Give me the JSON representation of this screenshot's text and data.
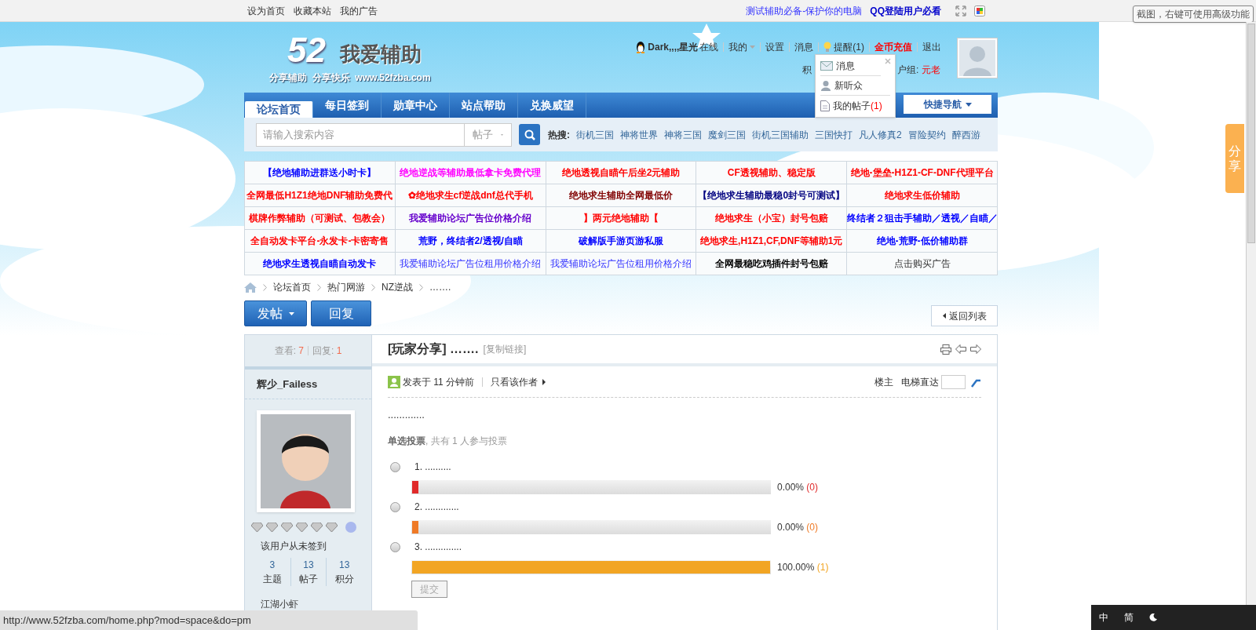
{
  "topbar": {
    "left_links": [
      "设为首页",
      "收藏本站",
      "我的广告"
    ],
    "right_links": [
      {
        "text": "测试辅助必备-保护你的电脑",
        "bold": false
      },
      {
        "text": "QQ登陆用户必看",
        "bold": true
      }
    ]
  },
  "tooltip": "截图，右键可使用高级功能",
  "header": {
    "logo": {
      "number": "52",
      "name": "我爱辅助",
      "slogan": "分享辅助  分享快乐  www.52fzba.com"
    },
    "user": {
      "name": "Dark,,,,星光",
      "status": "在线",
      "links": [
        {
          "text": "我的",
          "kind": "menu"
        },
        {
          "text": "设置",
          "kind": "link"
        },
        {
          "text": "消息",
          "kind": "link"
        },
        {
          "text": "提醒(1)",
          "kind": "alert"
        },
        {
          "text": "金币充值",
          "kind": "highlight"
        },
        {
          "text": "退出",
          "kind": "link"
        }
      ],
      "credit_label": "积",
      "group_label": "户组:",
      "group": "元老"
    },
    "popup": [
      {
        "text": "消息",
        "kind": "mail"
      },
      {
        "text": "新听众",
        "kind": "person"
      },
      {
        "text": "我的帖子",
        "count": "(1)",
        "kind": "doc"
      }
    ]
  },
  "nav": {
    "tabs": [
      {
        "label": "论坛首页",
        "selected": true
      },
      {
        "label": "每日签到",
        "selected": false
      },
      {
        "label": "勋章中心",
        "selected": false
      },
      {
        "label": "站点帮助",
        "selected": false
      },
      {
        "label": "兑换威望",
        "selected": false
      }
    ],
    "quick_nav": "快捷导航"
  },
  "search": {
    "placeholder": "请输入搜索内容",
    "type": "帖子",
    "hot_label": "热搜:",
    "hot": [
      "街机三国",
      "神将世界",
      "神将三国",
      "魔剑三国",
      "街机三国辅助",
      "三国快打",
      "凡人修真2",
      "冒险契约",
      "醉西游"
    ]
  },
  "ads": [
    [
      {
        "text": "【绝地辅助进群送小时卡】",
        "color": "#0000ff"
      },
      {
        "text": "绝地逆战等辅助最低拿卡免费代理",
        "color": "#ff00ff"
      },
      {
        "text": "绝地透视自瞄午后坐2元辅助",
        "color": "#ff0000"
      },
      {
        "text": "CF透视辅助、稳定版",
        "color": "#ff0000"
      },
      {
        "text": "绝地-堡垒-H1Z1-CF-DNF代理平台",
        "color": "#ff0000"
      }
    ],
    [
      {
        "text": "全网最低H1Z1绝地DNF辅助免费代",
        "color": "#ff0000"
      },
      {
        "text": "✿绝地求生cf逆战dnf总代手机",
        "color": "#ff0000"
      },
      {
        "text": "绝地求生辅助全网最低价",
        "color": "#800000"
      },
      {
        "text": "【绝地求生辅助最稳0封号可测试】",
        "color": "#000080"
      },
      {
        "text": "绝地求生低价辅助",
        "color": "#ff0000"
      }
    ],
    [
      {
        "text": "棋牌作弊辅助（可测试、包教会）",
        "color": "#ff0000"
      },
      {
        "text": "我爱辅助论坛广告位价格介绍",
        "color": "#6600cc"
      },
      {
        "text": "】两元绝地辅助【",
        "color": "#ff0000"
      },
      {
        "text": "绝地求生（小宝）封号包赔",
        "color": "#ff0000"
      },
      {
        "text": "终结者２狙击手辅助／透视／自瞄／",
        "color": "#0000ff"
      }
    ],
    [
      {
        "text": "全自动发卡平台-永发卡-卡密寄售",
        "color": "#ff0000"
      },
      {
        "text": "荒野，终结者2/透视/自瞄",
        "color": "#0000ff"
      },
      {
        "text": "破解版手游页游私服",
        "color": "#0000ff"
      },
      {
        "text": "绝地求生,H1Z1,CF,DNF等辅助1元",
        "color": "#ff0000"
      },
      {
        "text": "绝地-荒野-低价辅助群",
        "color": "#0000ff"
      }
    ],
    [
      {
        "text": "绝地求生透视自瞄自动发卡",
        "color": "#0000ff"
      },
      {
        "text": "我爱辅助论坛广告位租用价格介绍",
        "color": "#3333ff",
        "bold": false
      },
      {
        "text": "我爱辅助论坛广告位租用价格介绍",
        "color": "#3333ff",
        "bold": false
      },
      {
        "text": "全网最稳吃鸡插件封号包赔",
        "color": "#000000"
      },
      {
        "text": "点击购买广告",
        "bold": false
      }
    ]
  ],
  "breadcrumb": [
    "论坛首页",
    "热门网游",
    "NZ逆战",
    "……."
  ],
  "buttons": {
    "post": "发帖",
    "reply": "回复",
    "back": "返回列表"
  },
  "stats": {
    "views_label": "查看:",
    "views": "7",
    "replies_label": "回复:",
    "replies": "1"
  },
  "thread": {
    "title": "[玩家分享] …….",
    "copy_link": "[复制链接]"
  },
  "author": {
    "name": "辉少_Failess",
    "signin": "该用户从未签到",
    "counts": [
      {
        "value": "3",
        "label": "主题"
      },
      {
        "value": "13",
        "label": "帖子"
      },
      {
        "value": "13",
        "label": "积分"
      }
    ],
    "rank": "江湖小虾"
  },
  "post": {
    "time": "发表于 11 分钟前",
    "only_author": "只看该作者",
    "floor": "楼主",
    "jump": "电梯直达",
    "content": "............."
  },
  "poll": {
    "type": "单选投票",
    "summary": ", 共有 1 人参与投票",
    "options": [
      {
        "label": "1.  ..........",
        "level": 0.0,
        "percent": "0.00%",
        "count": "(0)",
        "color": "#e02a2a",
        "selected": false
      },
      {
        "label": "2.  .............",
        "level": 0.0,
        "percent": "0.00%",
        "count": "(0)",
        "color": "#ef7a26",
        "selected": false
      },
      {
        "label": "3.  ..............",
        "level": 1.0,
        "percent": "100.00%",
        "count": "(1)",
        "color": "#f2a523",
        "selected": false
      }
    ],
    "submit": "提交"
  },
  "share_tab": "分享",
  "status_url": "http://www.52fzba.com/home.php?mod=space&do=pm",
  "ime": [
    "中",
    "简"
  ]
}
